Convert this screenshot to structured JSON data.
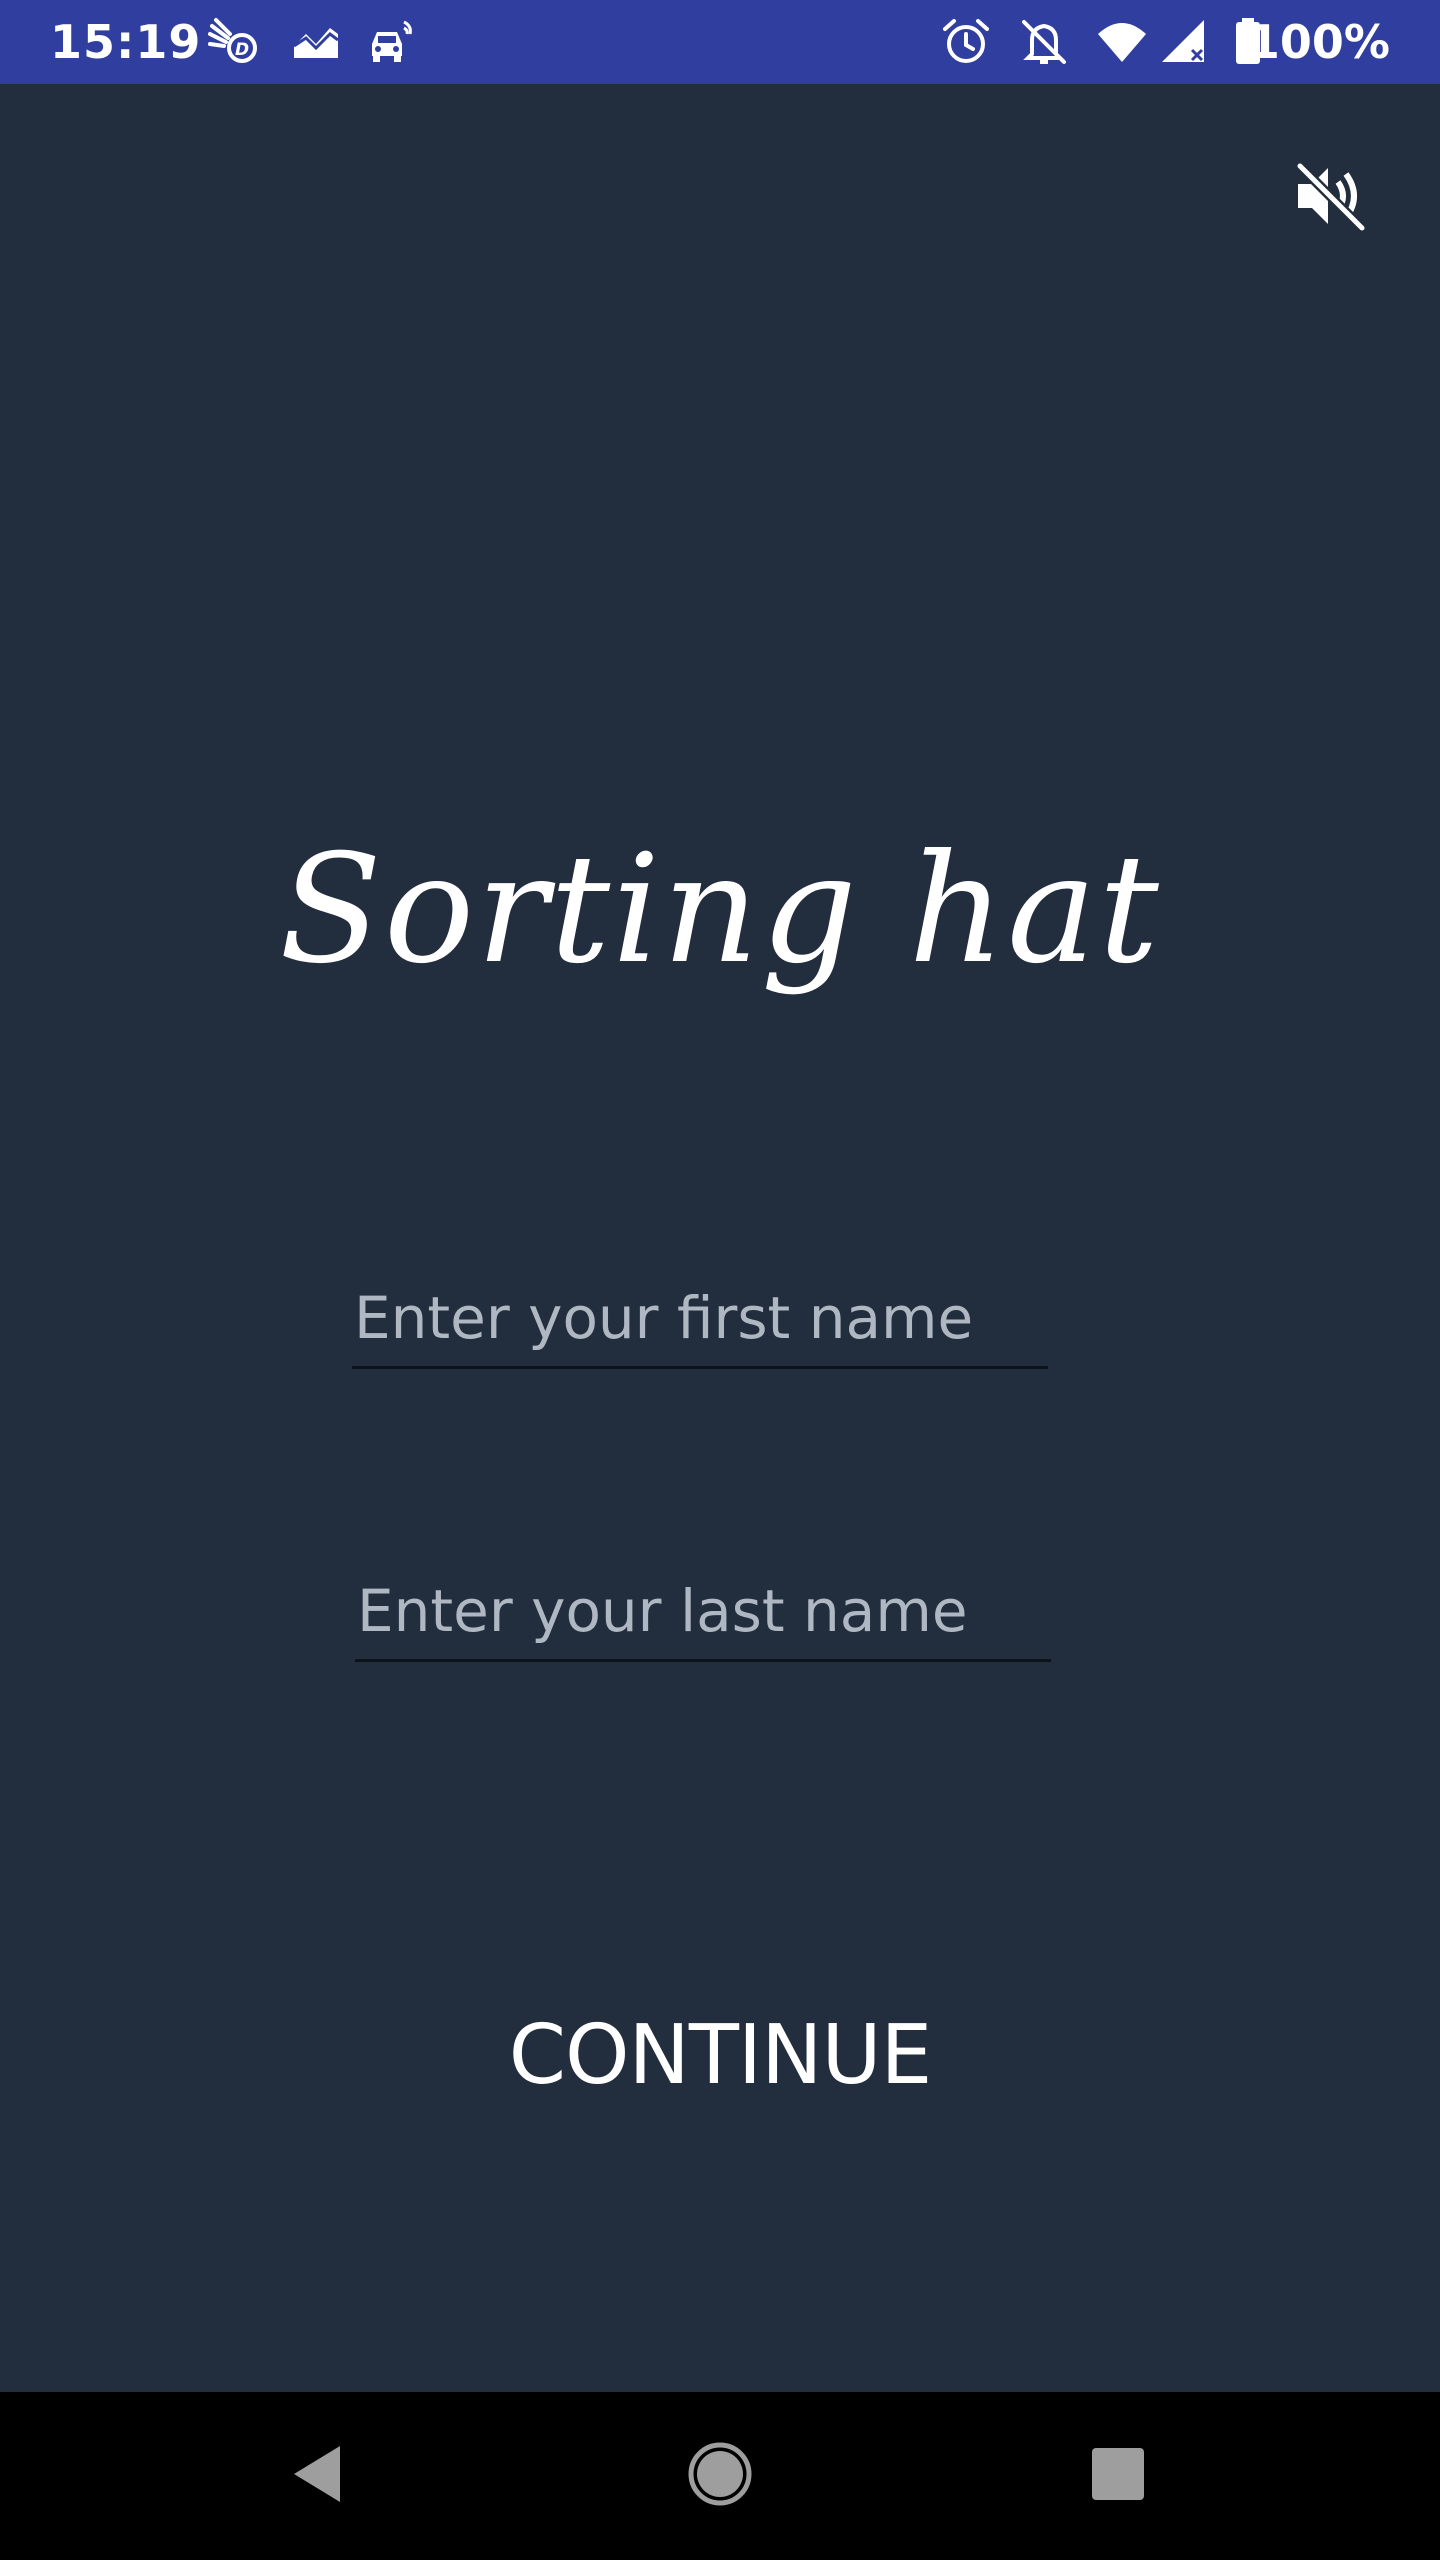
{
  "status_bar": {
    "time": "15:19",
    "battery_percent": "100%",
    "left_icons": [
      "hand-wave-icon",
      "chart-icon",
      "car-icon"
    ],
    "right_icons": [
      "alarm-icon",
      "notifications-off-icon",
      "wifi-icon",
      "signal-icon",
      "battery-icon"
    ],
    "background_color": "#303f9f"
  },
  "app": {
    "background_color": "#222e3d",
    "mute_icon": "volume-off-icon",
    "title": "Sorting hat",
    "first_name_placeholder": "Enter your first name",
    "last_name_placeholder": "Enter your last name",
    "continue_label": "CONTINUE"
  },
  "nav_bar": {
    "buttons": [
      "back-icon",
      "home-icon",
      "recents-icon"
    ]
  }
}
